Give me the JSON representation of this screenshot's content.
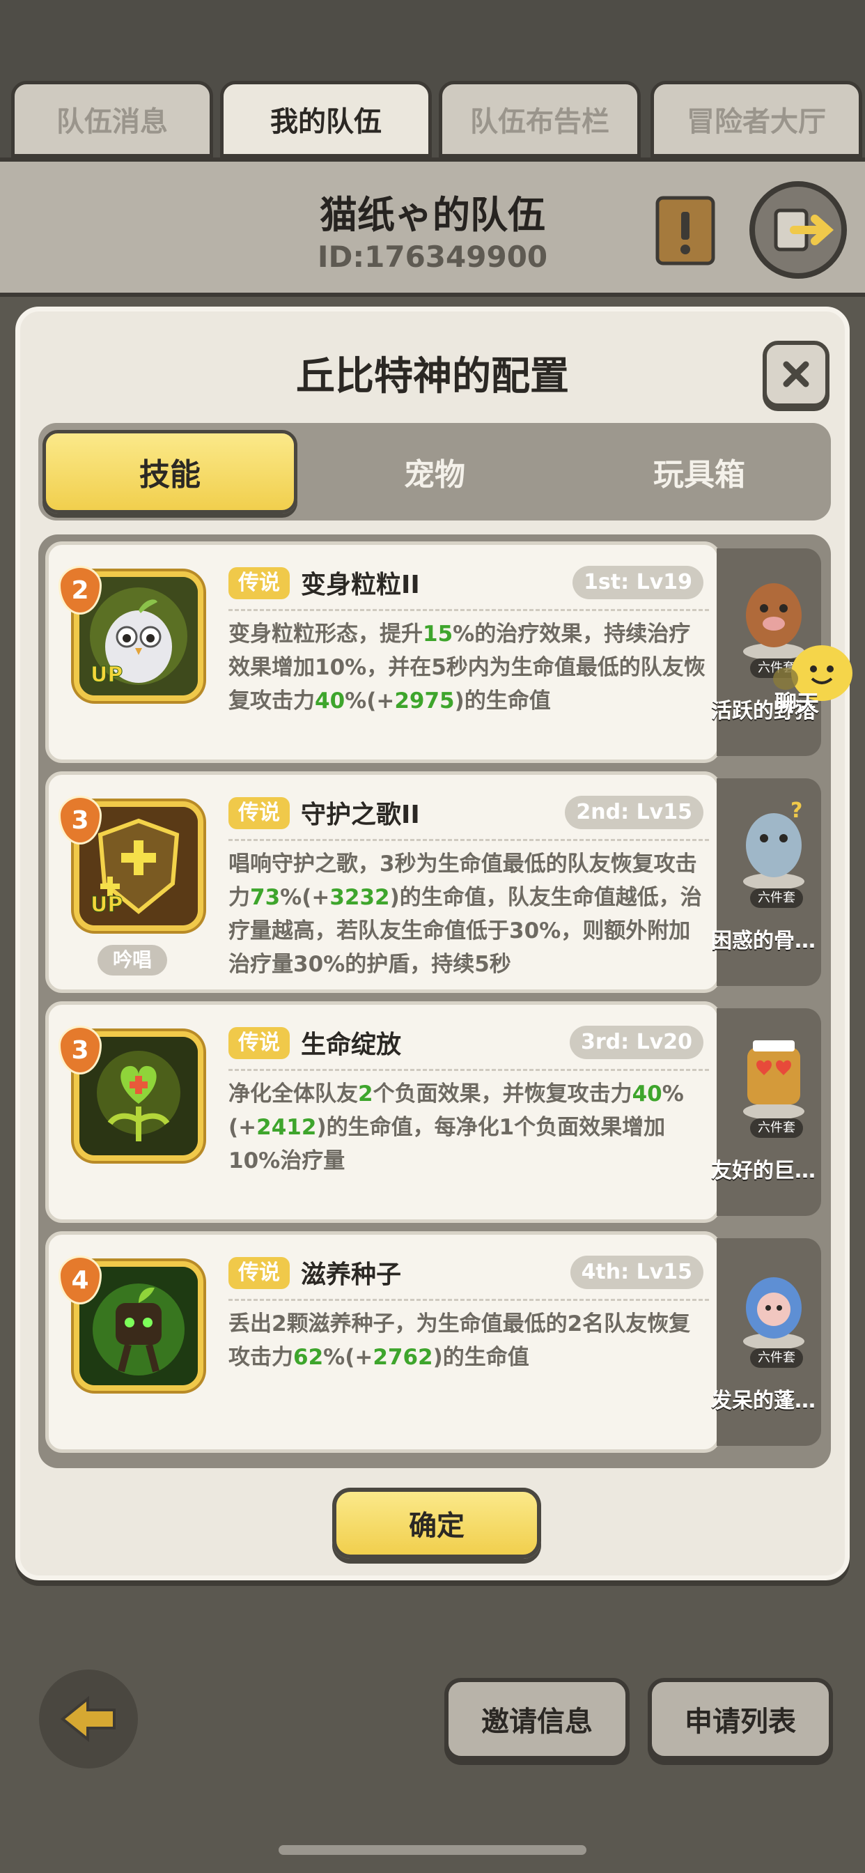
{
  "tabs": [
    "队伍消息",
    "我的队伍",
    "队伍布告栏",
    "冒险者大厅"
  ],
  "active_tab": 1,
  "team": {
    "name": "猫纸ゃ的队伍",
    "id": "ID:176349900"
  },
  "modal": {
    "title": "丘比特神的配置",
    "segments": [
      "技能",
      "宠物",
      "玩具箱"
    ],
    "active_segment": 0,
    "skills": [
      {
        "slot": "2",
        "up": "UP",
        "rarity": "传说",
        "name": "变身粒粒II",
        "level": "1st: Lv19",
        "desc": [
          [
            "变身粒粒形态，提升",
            false
          ],
          [
            "15",
            true
          ],
          [
            "%的治疗效果，持续治疗效果增加10%，并在5秒内为生命值最低的队友恢复攻击力",
            false
          ],
          [
            "40",
            true
          ],
          [
            "%(+",
            false
          ],
          [
            "2975",
            true
          ],
          [
            ")的生命值",
            false
          ]
        ],
        "chant": null
      },
      {
        "slot": "3",
        "up": "UP",
        "rarity": "传说",
        "name": "守护之歌II",
        "level": "2nd: Lv15",
        "desc": [
          [
            "唱响守护之歌，3秒为生命值最低的队友恢复攻击力",
            false
          ],
          [
            "73",
            true
          ],
          [
            "%(+",
            false
          ],
          [
            "3232",
            true
          ],
          [
            ")的生命值，队友生命值越低，治疗量越高，若队友生命值低于30%，则额外附加治疗量30%的护盾，持续5秒",
            false
          ]
        ],
        "chant": "吟唱"
      },
      {
        "slot": "3",
        "up": "",
        "rarity": "传说",
        "name": "生命绽放",
        "level": "3rd: Lv20",
        "desc": [
          [
            "净化全体队友",
            false
          ],
          [
            "2",
            true
          ],
          [
            "个负面效果，并恢复攻击力",
            false
          ],
          [
            "40",
            true
          ],
          [
            "%(+",
            false
          ],
          [
            "2412",
            true
          ],
          [
            ")的生命值，每净化1个负面效果增加10%治疗量",
            false
          ]
        ],
        "chant": null
      },
      {
        "slot": "4",
        "up": "",
        "rarity": "传说",
        "name": "滋养种子",
        "level": "4th: Lv15",
        "desc": [
          [
            "丢出2颗滋养种子，为生命值最低的2名队友恢复攻击力",
            false
          ],
          [
            "62",
            true
          ],
          [
            "%(+",
            false
          ],
          [
            "2762",
            true
          ],
          [
            ")的生命值",
            false
          ]
        ],
        "chant": null
      }
    ],
    "pets": [
      {
        "set": "六件套",
        "name": "活跃的野猪",
        "color": "#b06a3a"
      },
      {
        "set": "六件套",
        "name": "困惑的骨…",
        "color": "#9fb7c8"
      },
      {
        "set": "六件套",
        "name": "友好的巨…",
        "color": "#d49a3a"
      },
      {
        "set": "六件套",
        "name": "发呆的蓬…",
        "color": "#5e8fd4"
      }
    ],
    "confirm_label": "确定"
  },
  "chat_label": "聊天",
  "bottom": {
    "invite_label": "邀请信息",
    "apply_label": "申请列表"
  },
  "colors": {
    "gold": "#f0c94a",
    "green": "#3ea52c",
    "dark": "#2b2824"
  }
}
